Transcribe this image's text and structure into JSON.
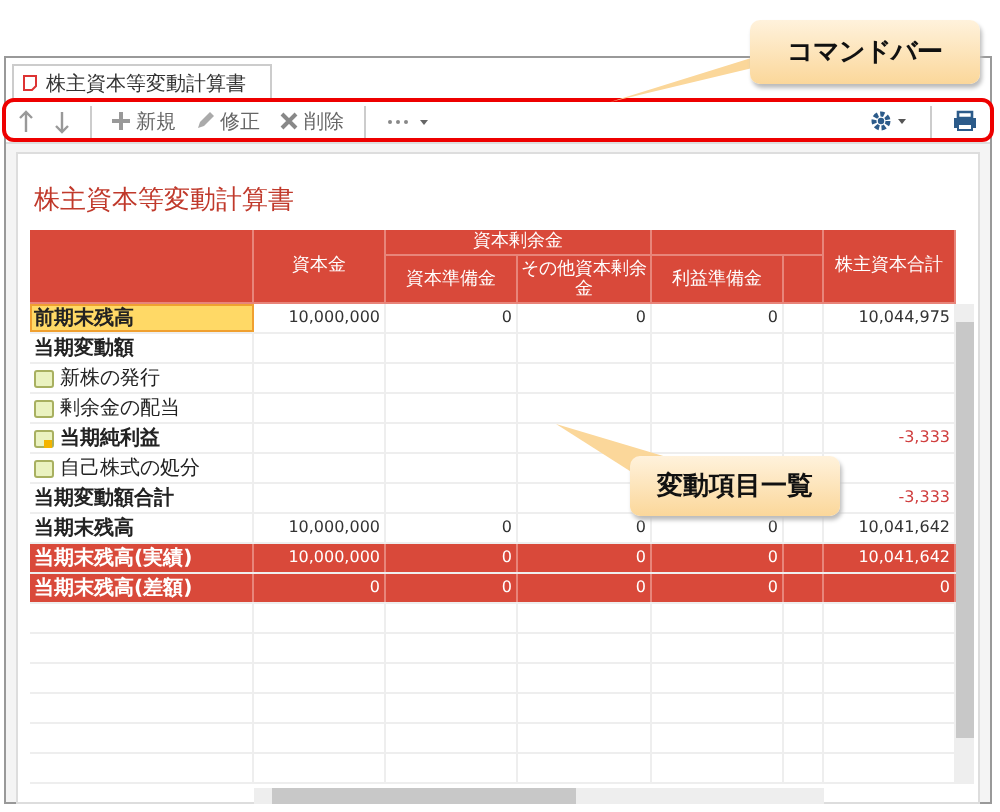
{
  "tab": {
    "title": "株主資本等変動計算書",
    "selected": true
  },
  "toolbar": {
    "buttons": [
      {
        "kind": "new",
        "label": "新規"
      },
      {
        "kind": "edit",
        "label": "修正"
      },
      {
        "kind": "delete",
        "label": "削除"
      }
    ]
  },
  "page_title": "株主資本等変動計算書",
  "table": {
    "header": {
      "capital": "資本金",
      "group": "資本剰余金",
      "capital_reserve": "資本準備金",
      "other_capital_surplus": "その他資本剰余金",
      "retained_reserve": "利益準備金",
      "total": "株主資本合計"
    },
    "rows": [
      {
        "label": "前期末残高",
        "kind": "heading",
        "bold": true,
        "selected": true,
        "cells": {
          "capital": "10,000,000",
          "capital_reserve": "0",
          "other_capital_surplus": "0",
          "retained_reserve": "0",
          "total": "10,044,975"
        }
      },
      {
        "label": "当期変動額",
        "kind": "heading",
        "bold": true,
        "selected": false,
        "cells": {}
      },
      {
        "label": "新株の発行",
        "kind": "item",
        "flagged": false,
        "bold": false,
        "selected": false,
        "cells": {}
      },
      {
        "label": "剰余金の配当",
        "kind": "item",
        "flagged": false,
        "bold": false,
        "selected": false,
        "cells": {}
      },
      {
        "label": "当期純利益",
        "kind": "item",
        "flagged": true,
        "bold": true,
        "selected": false,
        "total_negative": true,
        "cells": {
          "total": "-3,333"
        }
      },
      {
        "label": "自己株式の処分",
        "kind": "item",
        "flagged": false,
        "bold": false,
        "selected": false,
        "cells": {}
      },
      {
        "label": "当期変動額合計",
        "kind": "heading",
        "bold": true,
        "selected": false,
        "total_negative": true,
        "cells": {
          "total": "-3,333"
        }
      },
      {
        "label": "当期末残高",
        "kind": "heading",
        "bold": true,
        "selected": false,
        "cells": {
          "capital": "10,000,000",
          "capital_reserve": "0",
          "other_capital_surplus": "0",
          "retained_reserve": "0",
          "total": "10,041,642"
        }
      },
      {
        "label": "当期末残高(実績)",
        "kind": "result",
        "bold": true,
        "selected": false,
        "cells": {
          "capital": "10,000,000",
          "capital_reserve": "0",
          "other_capital_surplus": "0",
          "retained_reserve": "0",
          "total": "10,041,642"
        }
      },
      {
        "label": "当期末残高(差額)",
        "kind": "result",
        "bold": true,
        "selected": false,
        "cells": {
          "capital": "0",
          "capital_reserve": "0",
          "other_capital_surplus": "0",
          "retained_reserve": "0",
          "total": "0"
        }
      }
    ]
  },
  "callouts": [
    {
      "kind": "toolbar",
      "text": "コマンドバー"
    },
    {
      "kind": "list",
      "text": "変動項目一覧"
    }
  ]
}
